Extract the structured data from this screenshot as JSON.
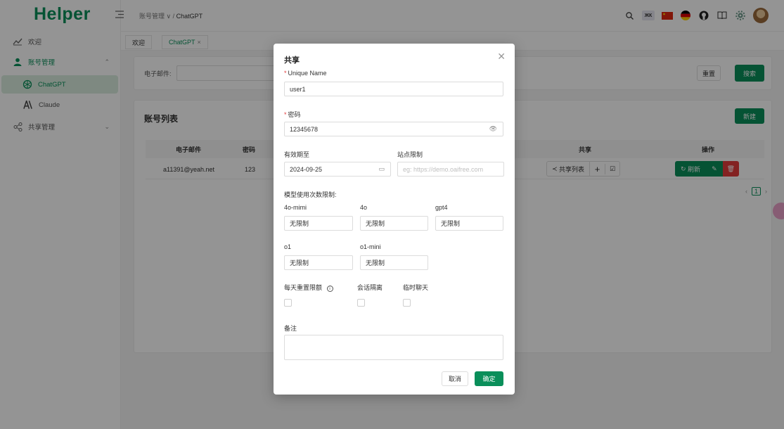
{
  "app": {
    "logo": "Helper"
  },
  "sidebar": {
    "items": [
      {
        "label": "欢迎",
        "icon": "chart-icon"
      },
      {
        "label": "账号管理",
        "icon": "user-icon"
      },
      {
        "label": "ChatGPT",
        "icon": "openai-icon"
      },
      {
        "label": "Claude",
        "icon": "anthropic-icon"
      },
      {
        "label": "共享管理",
        "icon": "share-icon"
      }
    ]
  },
  "header": {
    "breadcrumb_parent": "账号管理",
    "breadcrumb_sep": " / ",
    "breadcrumb_current": "ChatGPT",
    "lang_badge": "ЖК"
  },
  "tabs": [
    {
      "label": "欢迎"
    },
    {
      "label": "ChatGPT"
    }
  ],
  "search": {
    "email_label": "电子邮件:",
    "reset_label": "重置",
    "search_label": "搜索"
  },
  "list": {
    "title": "账号列表",
    "new_label": "新建",
    "columns": [
      "电子邮件",
      "密码",
      "共享",
      "操作"
    ],
    "rows": [
      {
        "email": "a11391@yeah.net",
        "password": "123",
        "share_label": "共享列表",
        "refresh_label": "刷新"
      }
    ],
    "page": "1"
  },
  "modal": {
    "title": "共享",
    "unique_name_label": "Unique Name",
    "unique_name_value": "user1",
    "password_label": "密码",
    "password_value": "12345678",
    "expiry_label": "有效期至",
    "expiry_value": "2024-09-25",
    "site_limit_label": "站点限制",
    "site_limit_placeholder": "eg: https://demo.oaifree.com",
    "model_limit_label": "模型使用次数限制:",
    "models": [
      {
        "name": "4o-mimi",
        "value": "无限制"
      },
      {
        "name": "4o",
        "value": "无限制"
      },
      {
        "name": "gpt4",
        "value": "无限制"
      },
      {
        "name": "o1",
        "value": "无限制"
      },
      {
        "name": "o1-mini",
        "value": "无限制"
      }
    ],
    "daily_reset_label": "每天重置限额",
    "session_isolation_label": "会话隔离",
    "temp_chat_label": "临时聊天",
    "remark_label": "备注",
    "cancel_label": "取消",
    "confirm_label": "确定"
  },
  "colors": {
    "accent": "#0a8f5a",
    "danger": "#e23c3c"
  }
}
